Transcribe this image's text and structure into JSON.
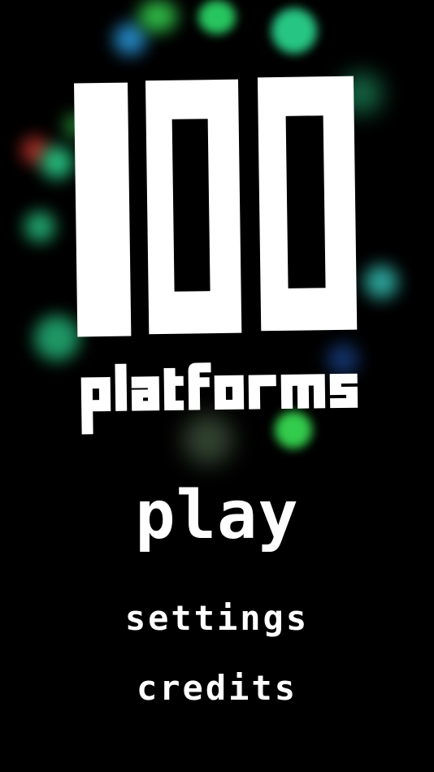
{
  "logo": {
    "number": "100",
    "subtitle": "platforms"
  },
  "menu": {
    "play_label": "play",
    "settings_label": "settings",
    "credits_label": "credits"
  },
  "colors": {
    "background": "#000000",
    "text": "#ffffff",
    "particle_green": "#2ee89a",
    "particle_bright_green": "#3cf05a",
    "particle_cyan": "#3ad4c8",
    "particle_blue": "#2a9be0",
    "particle_red": "#c0302a"
  }
}
